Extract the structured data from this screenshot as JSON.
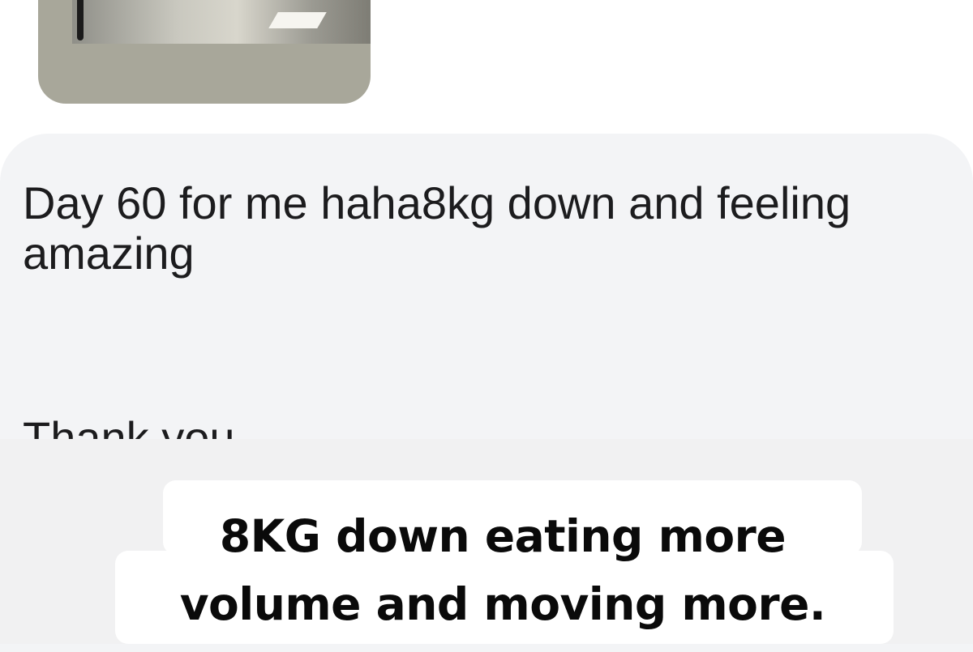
{
  "post": {
    "photo_icon": "photo-thumbnail"
  },
  "comment": {
    "text": "Day 60 for me haha8kg down and feeling amazing",
    "clipped_next_line": "Thank you ."
  },
  "caption": {
    "line1": "8KG down eating more",
    "line2": "volume and moving more."
  },
  "colors": {
    "card_background": "#f3f4f6",
    "text": "#1c1c1e",
    "caption_background": "#ffffff"
  }
}
